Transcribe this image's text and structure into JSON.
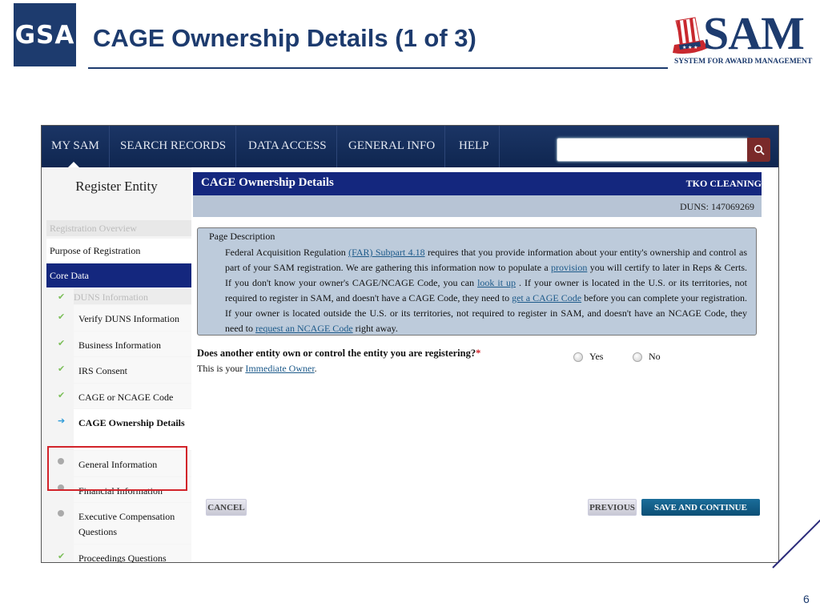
{
  "slide": {
    "title": "CAGE Ownership Details (1 of 3)",
    "gsa_logo": "GSA",
    "sam_logo": "SAM",
    "sam_tagline": "SYSTEM FOR AWARD MANAGEMENT",
    "page_number": "6"
  },
  "nav": {
    "items": [
      "MY SAM",
      "SEARCH RECORDS",
      "DATA ACCESS",
      "GENERAL INFO",
      "HELP"
    ],
    "search_placeholder": "",
    "search_icon": "search-icon"
  },
  "sidebar": {
    "heading": "Register Entity",
    "registration_overview": "Registration Overview",
    "purpose": "Purpose of Registration",
    "core_data": "Core Data",
    "items": [
      {
        "label": "DUNS Information",
        "status": "check",
        "disabled": true
      },
      {
        "label": "Verify DUNS Information",
        "status": "check"
      },
      {
        "label": "Business Information",
        "status": "check"
      },
      {
        "label": "IRS Consent",
        "status": "check"
      },
      {
        "label": "CAGE or NCAGE Code",
        "status": "check"
      },
      {
        "label": "CAGE Ownership Details",
        "status": "current"
      },
      {
        "label": "General Information",
        "status": "pending"
      },
      {
        "label": "Financial Information",
        "status": "pending"
      },
      {
        "label": "Executive Compensation Questions",
        "status": "pending"
      },
      {
        "label": "Proceedings Questions",
        "status": "check"
      }
    ]
  },
  "main": {
    "title": "CAGE Ownership Details",
    "entity_name": "TKO CLEANING",
    "duns_label": "DUNS:",
    "duns_value": "147069269",
    "description": {
      "heading": "Page Description",
      "t1": "Federal Acquisition Regulation ",
      "link1": "(FAR) Subpart 4.18",
      "t2": " requires that you provide information about your entity's ownership and control as part of your SAM registration. We are gathering this information now to populate a ",
      "link2": "provision",
      "t3": " you will certify to later in Reps & Certs. If you don't know your owner's CAGE/NCAGE Code, you can ",
      "link3": "look it up",
      "t4": " . If your owner is located in the U.S. or its territories, not required to register in SAM, and doesn't have a CAGE Code, they need to ",
      "link4": "get a CAGE Code",
      "t5": " before you can complete your registration. If your owner is located outside the U.S. or its territories, not required to register in SAM, and doesn't have an NCAGE Code, they need to ",
      "link5": "request an NCAGE Code",
      "t6": " right away."
    },
    "question": "Does another entity own or control the entity you are registering?",
    "required_mark": "*",
    "owner_prefix": "This is your ",
    "owner_link": "Immediate Owner",
    "owner_suffix": ".",
    "options": [
      "Yes",
      "No"
    ],
    "buttons": {
      "cancel": "CANCEL",
      "previous": "PREVIOUS",
      "save": "SAVE AND CONTINUE"
    }
  }
}
